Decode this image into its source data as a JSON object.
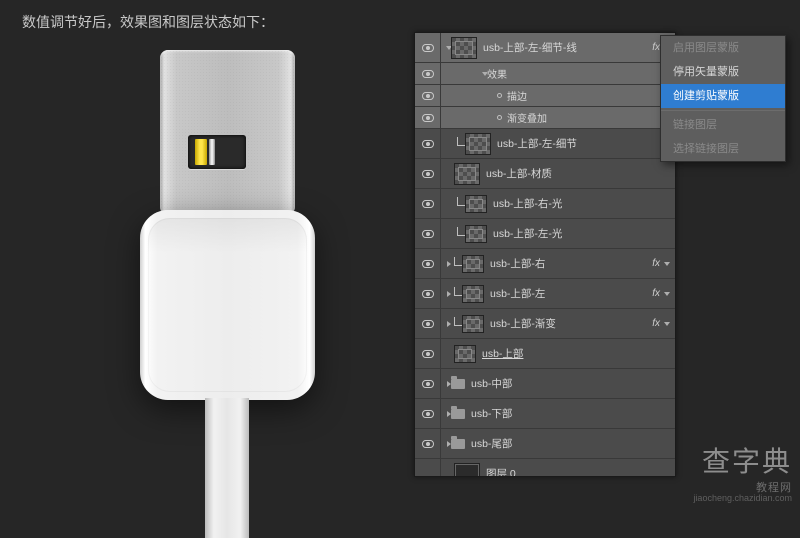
{
  "caption": "数值调节好后，效果图和图层状态如下：",
  "panel": {
    "fx_label": "fx",
    "effects_label": "效果",
    "sub_stroke": "描边",
    "sub_gradient": "渐变叠加"
  },
  "layers": [
    {
      "name": "usb-上部-左-细节-线",
      "fx": true,
      "selected": true,
      "thumb": "t"
    },
    {
      "name": "usb-上部-左-细节",
      "thumb": "t",
      "clip": true
    },
    {
      "name": "usb-上部-材质",
      "thumb": "t"
    },
    {
      "name": "usb-上部-右-光",
      "thumb": "t",
      "clip": true,
      "small": true
    },
    {
      "name": "usb-上部-左-光",
      "thumb": "t",
      "clip": true,
      "small": true
    },
    {
      "name": "usb-上部-右",
      "fx": true,
      "thumb": "t",
      "clip": true,
      "small": true
    },
    {
      "name": "usb-上部-左",
      "fx": true,
      "thumb": "t",
      "clip": true,
      "small": true
    },
    {
      "name": "usb-上部-渐变",
      "fx": true,
      "thumb": "t",
      "clip": true,
      "small": true
    },
    {
      "name": "usb-上部",
      "thumb": "t",
      "underline": true,
      "small": true
    },
    {
      "name": "usb-中部",
      "folder": true
    },
    {
      "name": "usb-下部",
      "folder": true
    },
    {
      "name": "usb-尾部",
      "folder": true
    },
    {
      "name": "图层 0",
      "thumb": "d",
      "vis": false
    }
  ],
  "ctx": {
    "items": [
      {
        "label": "启用图层蒙版",
        "disabled": true
      },
      {
        "label": "停用矢量蒙版"
      },
      {
        "label": "创建剪贴蒙版",
        "highlight": true
      },
      {
        "sep": true
      },
      {
        "label": "链接图层",
        "disabled": true
      },
      {
        "label": "选择链接图层",
        "disabled": true
      }
    ]
  },
  "watermark": {
    "big": "查字典",
    "under": "教程网",
    "url": "jiaocheng.chazidian.com"
  }
}
